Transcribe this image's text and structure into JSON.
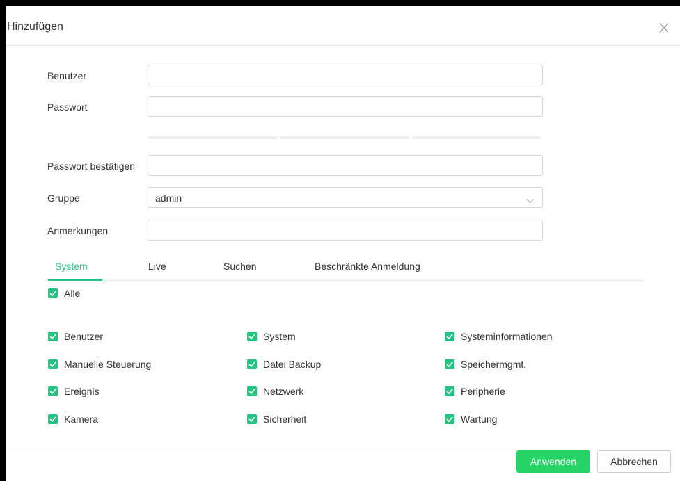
{
  "dialog": {
    "title": "Hinzufügen",
    "close_icon": "close-icon"
  },
  "form": {
    "user_label": "Benutzer",
    "user_value": "",
    "password_label": "Passwort",
    "password_value": "",
    "confirm_label": "Passwort bestätigen",
    "confirm_value": "",
    "group_label": "Gruppe",
    "group_value": "admin",
    "notes_label": "Anmerkungen",
    "notes_value": ""
  },
  "tabs": [
    {
      "label": "System",
      "active": true
    },
    {
      "label": "Live",
      "active": false
    },
    {
      "label": "Suchen",
      "active": false
    },
    {
      "label": "Beschränkte Anmeldung",
      "active": false
    }
  ],
  "permissions": {
    "all_label": "Alle",
    "items": [
      {
        "label": "Benutzer",
        "checked": true
      },
      {
        "label": "System",
        "checked": true
      },
      {
        "label": "Systeminformationen",
        "checked": true
      },
      {
        "label": "Manuelle Steuerung",
        "checked": true
      },
      {
        "label": "Datei Backup",
        "checked": true
      },
      {
        "label": "Speichermgmt.",
        "checked": true
      },
      {
        "label": "Ereignis",
        "checked": true
      },
      {
        "label": "Netzwerk",
        "checked": true
      },
      {
        "label": "Peripherie",
        "checked": true
      },
      {
        "label": "Kamera",
        "checked": true
      },
      {
        "label": "Sicherheit",
        "checked": true
      },
      {
        "label": "Wartung",
        "checked": true
      }
    ]
  },
  "footer": {
    "apply_label": "Anwenden",
    "cancel_label": "Abbrechen"
  },
  "colors": {
    "accent": "#26c281",
    "primary_button": "#25d366"
  }
}
